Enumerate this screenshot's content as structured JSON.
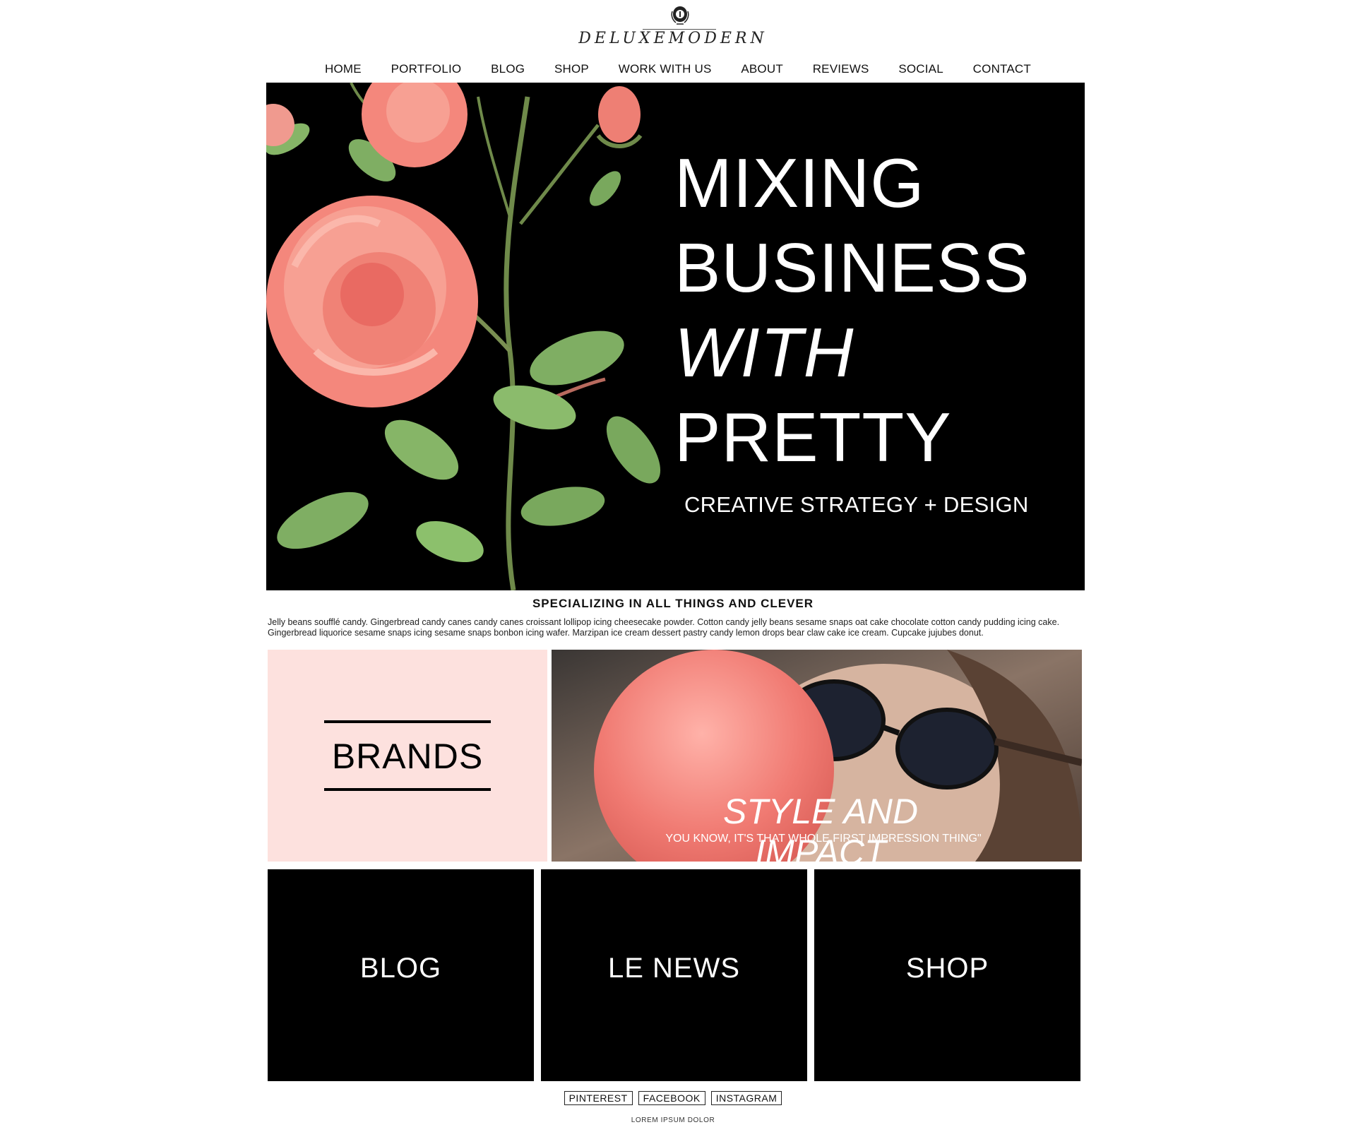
{
  "brand": {
    "logo_text": "DELUXEMODERN"
  },
  "nav": {
    "items": [
      {
        "label": "HOME"
      },
      {
        "label": "PORTFOLIO"
      },
      {
        "label": "BLOG"
      },
      {
        "label": "SHOP"
      },
      {
        "label": "WORK WITH US"
      },
      {
        "label": "ABOUT"
      },
      {
        "label": "REVIEWS"
      },
      {
        "label": "SOCIAL"
      },
      {
        "label": "CONTACT"
      }
    ]
  },
  "hero": {
    "line1": "MIXING",
    "line2": "BUSINESS",
    "line3": "WITH",
    "line4": "PRETTY",
    "subtitle": "CREATIVE STRATEGY + DESIGN"
  },
  "intro": {
    "title": "SPECIALIZING IN ALL THINGS AND CLEVER",
    "body": "Jelly beans soufflé candy. Gingerbread candy canes candy canes croissant lollipop icing cheesecake powder. Cotton candy jelly beans sesame snaps oat cake chocolate cotton candy pudding icing cake. Gingerbread liquorice sesame snaps icing sesame snaps bonbon icing wafer. Marzipan ice cream dessert pastry candy lemon drops bear claw cake ice cream. Cupcake jujubes donut."
  },
  "features": {
    "brands_label": "BRANDS",
    "style_title": "STYLE AND IMPACT",
    "style_subtitle": "YOU KNOW, IT'S THAT WHOLE FIRST IMPRESSION THING\""
  },
  "tiles": [
    {
      "label": "BLOG"
    },
    {
      "label": "LE NEWS"
    },
    {
      "label": "SHOP"
    }
  ],
  "footer": {
    "social": [
      {
        "label": "PINTEREST"
      },
      {
        "label": "FACEBOOK"
      },
      {
        "label": "INSTAGRAM"
      }
    ],
    "note": "LOREM IPSUM DOLOR"
  },
  "colors": {
    "hero_bg": "#000000",
    "brands_bg": "#fde1de",
    "rose": "#f4877c",
    "leaf": "#7fae63"
  }
}
